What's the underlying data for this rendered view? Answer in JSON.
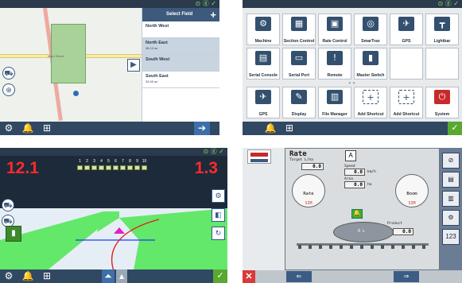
{
  "panel1": {
    "map": {
      "road_label": "Main Street"
    },
    "field_list": {
      "header": "Select Field",
      "add_icon": "+",
      "items": [
        {
          "name": "North West",
          "sub": ""
        },
        {
          "name": "North East",
          "sub": "46.12 ac"
        },
        {
          "name": "South West",
          "sub": ""
        },
        {
          "name": "South East",
          "sub": "33.40 ac"
        }
      ]
    }
  },
  "panel2": {
    "tiles_row1": [
      {
        "label": "Machine",
        "icon": "⚙"
      },
      {
        "label": "Section Control",
        "icon": "▦"
      },
      {
        "label": "Rate Control",
        "icon": "▣"
      },
      {
        "label": "SmarTrax",
        "icon": "◎"
      },
      {
        "label": "GPS",
        "icon": "✈"
      },
      {
        "label": "Lightbar",
        "icon": "┳"
      }
    ],
    "tiles_row2": [
      {
        "label": "Serial Console",
        "icon": "▤"
      },
      {
        "label": "Serial Port",
        "icon": "▭"
      },
      {
        "label": "Remote Support",
        "icon": "!"
      },
      {
        "label": "Master Switch",
        "icon": "▮"
      }
    ],
    "tiles_row3": [
      {
        "label": "GPS",
        "icon": "✈"
      },
      {
        "label": "Display",
        "icon": "✎"
      },
      {
        "label": "File Manager",
        "icon": "▥"
      },
      {
        "label": "Add Shortcut",
        "icon": "+"
      },
      {
        "label": "Add Shortcut",
        "icon": "+"
      },
      {
        "label": "System Shutdown",
        "icon": "⏻"
      }
    ]
  },
  "panel3": {
    "rate_left": "12.1",
    "rate_right": "1.3",
    "sections": [
      "1",
      "2",
      "3",
      "4",
      "5",
      "6",
      "7",
      "8",
      "9",
      "10"
    ]
  },
  "panel4": {
    "title": "Rate",
    "target_label": "Target  L/ha",
    "target_value": "0.0",
    "speed_label": "Speed",
    "speed_value": "0.0",
    "speed_unit": "km/h",
    "area_label": "Area",
    "area_value": "0.0",
    "area_unit": "ha",
    "gauge1_name": "Rate",
    "gauge1_sim": "SIM",
    "gauge2_name": "Boom",
    "gauge2_sim": "SIM",
    "product_label": "Product",
    "product_value": "0.0",
    "tank_value": "0",
    "tank_unit": "L",
    "button_123": "123"
  }
}
